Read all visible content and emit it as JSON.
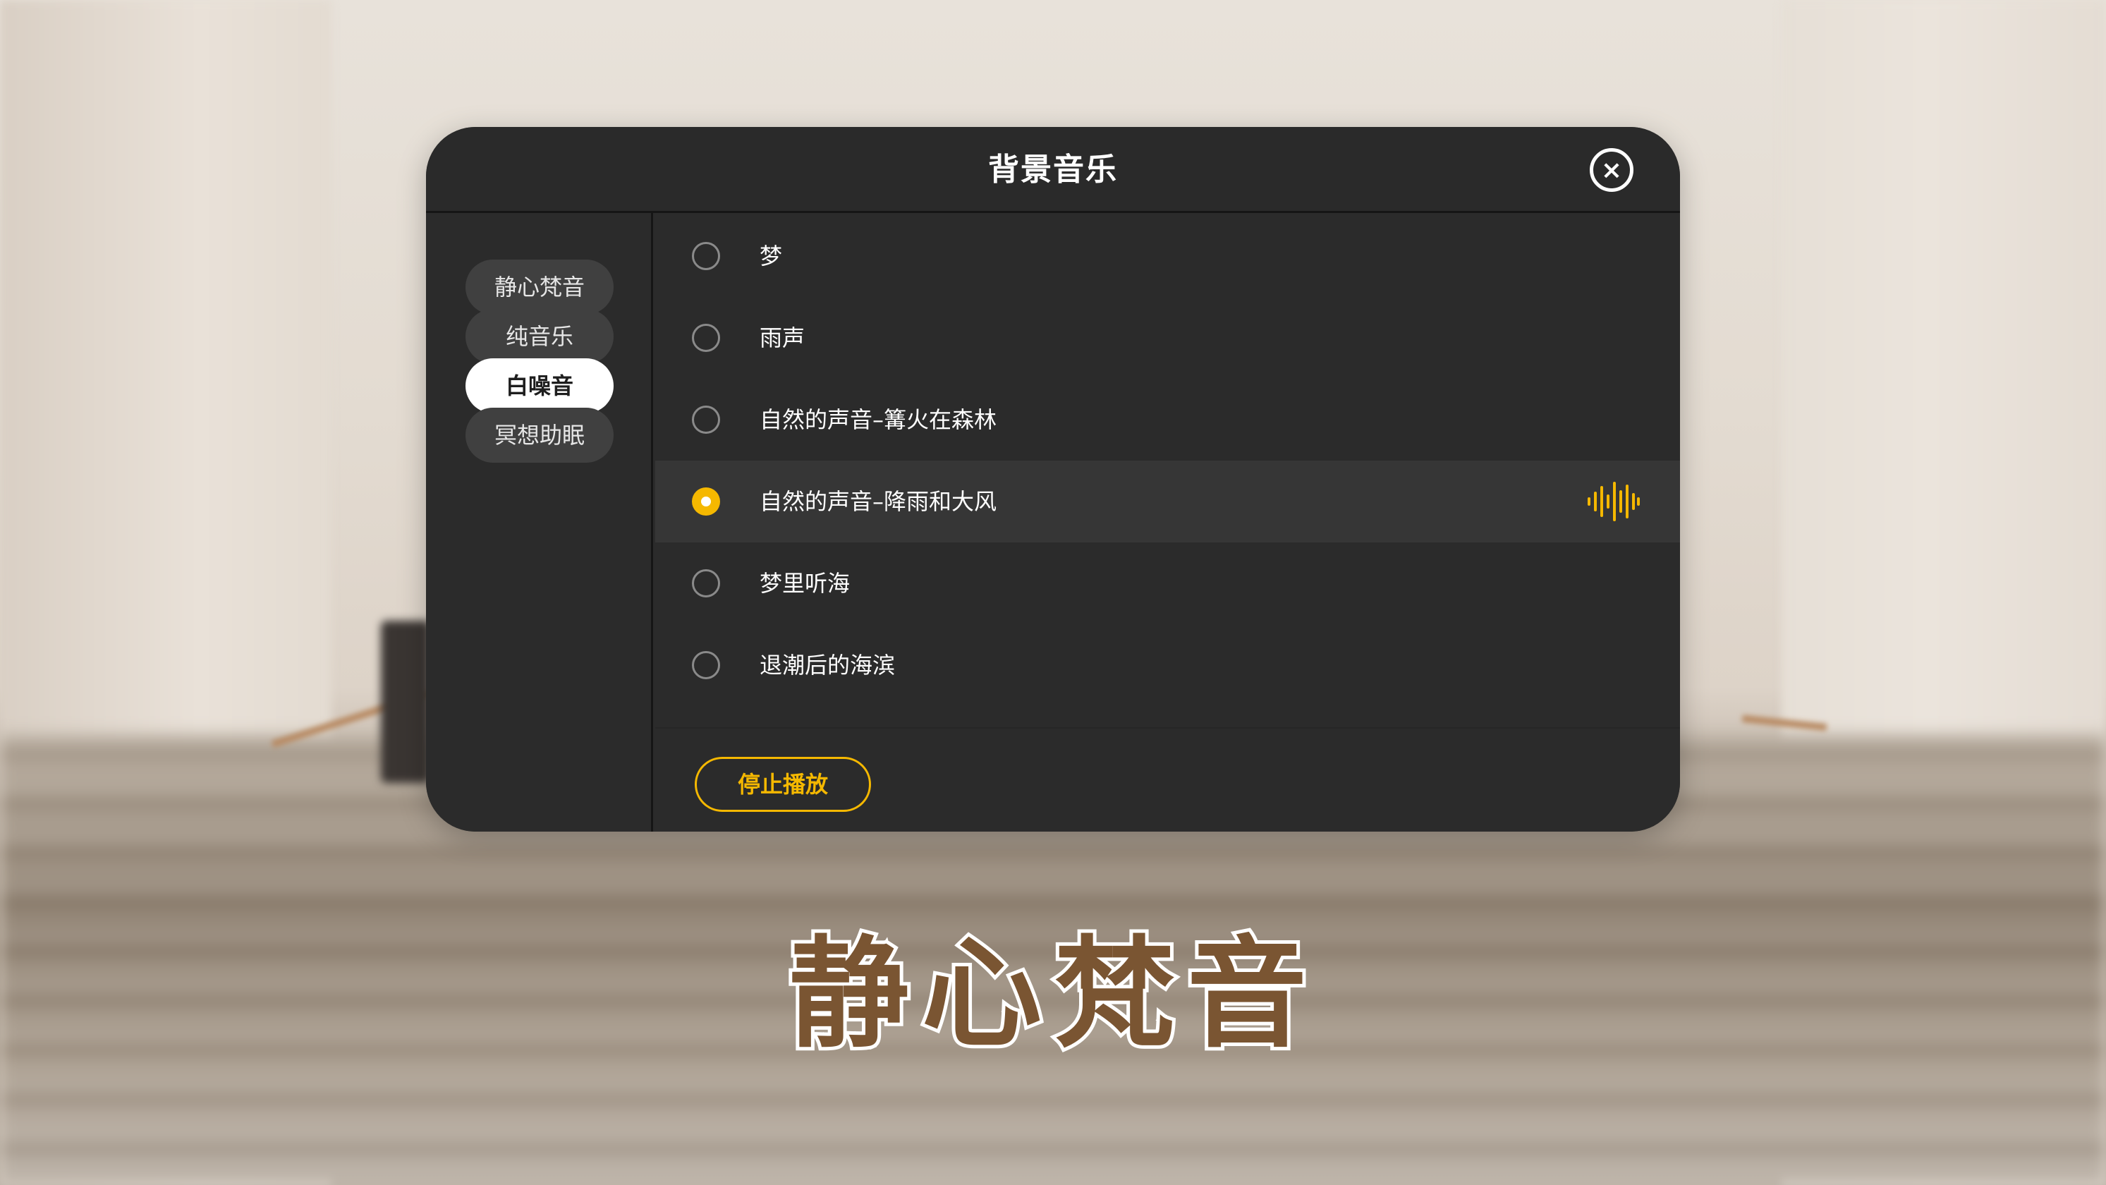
{
  "dialog": {
    "title": "背景音乐",
    "close_label": "×"
  },
  "categories": [
    {
      "label": "静心梵音",
      "active": false
    },
    {
      "label": "纯音乐",
      "active": false
    },
    {
      "label": "白噪音",
      "active": true
    },
    {
      "label": "冥想助眠",
      "active": false
    }
  ],
  "tracks": [
    {
      "label": "梦",
      "selected": false
    },
    {
      "label": "雨声",
      "selected": false
    },
    {
      "label": "自然的声音–篝火在森林",
      "selected": false
    },
    {
      "label": "自然的声音–降雨和大风",
      "selected": true,
      "playing_indicator": "sound-wave-icon"
    },
    {
      "label": "梦里听海",
      "selected": false
    },
    {
      "label": "退潮后的海滨",
      "selected": false
    }
  ],
  "footer": {
    "stop_label": "停止播放"
  },
  "brand": {
    "logo_text": "静心梵音"
  },
  "colors": {
    "accent": "#f5b800",
    "panel": "#2b2b2b",
    "selected_row": "#363636",
    "logo_fill": "#7a5532"
  }
}
